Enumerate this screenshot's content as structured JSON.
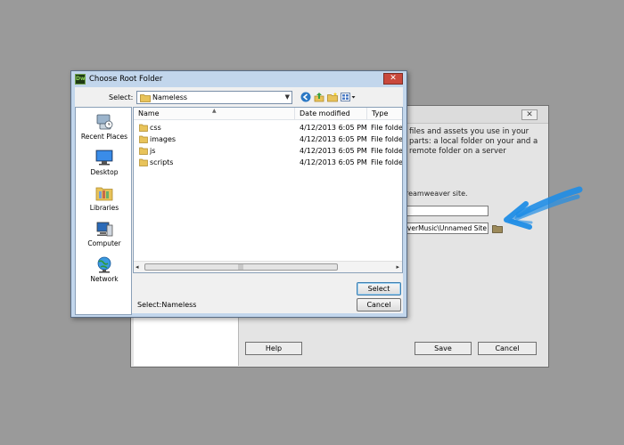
{
  "background_dialog": {
    "description": "files and assets you use in your parts: a local folder on your and a remote folder on a server",
    "site_label": "r Dreamweaver site.",
    "site_name_value": "",
    "local_folder_value": "DreamWeaverMusic\\Unnamed Site",
    "help_label": "Help",
    "save_label": "Save",
    "cancel_label": "Cancel",
    "close_glyph": "✕"
  },
  "dialog": {
    "title": "Choose Root Folder",
    "app_icon_text": "Dw",
    "close_glyph": "✕",
    "select_label": "Select:",
    "location_value": "Nameless",
    "places": [
      {
        "label": "Recent Places",
        "icon": "recent-places-icon"
      },
      {
        "label": "Desktop",
        "icon": "desktop-icon"
      },
      {
        "label": "Libraries",
        "icon": "libraries-icon"
      },
      {
        "label": "Computer",
        "icon": "computer-icon"
      },
      {
        "label": "Network",
        "icon": "network-icon"
      }
    ],
    "columns": {
      "name": "Name",
      "date": "Date modified",
      "type": "Type"
    },
    "files": [
      {
        "name": "css",
        "date": "4/12/2013 6:05 PM",
        "type": "File folder"
      },
      {
        "name": "images",
        "date": "4/12/2013 6:05 PM",
        "type": "File folder"
      },
      {
        "name": "js",
        "date": "4/12/2013 6:05 PM",
        "type": "File folder"
      },
      {
        "name": "scripts",
        "date": "4/12/2013 6:05 PM",
        "type": "File folder"
      }
    ],
    "status": "Select:Nameless",
    "select_button": "Select",
    "cancel_button": "Cancel"
  },
  "colors": {
    "annotation_arrow": "#1f8de6",
    "title_bar": "#c2d6ec",
    "close_button": "#c9483c",
    "folder": "#e8c35a"
  }
}
